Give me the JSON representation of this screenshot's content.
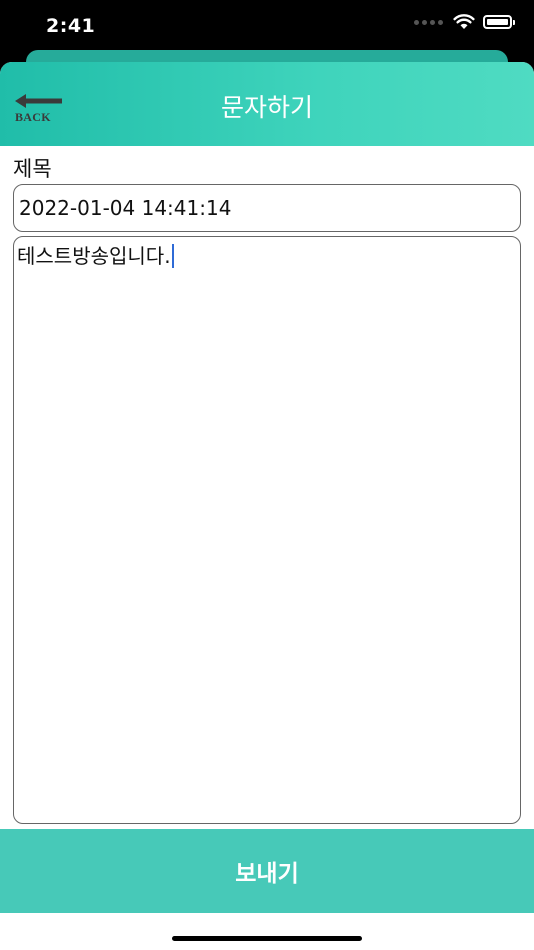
{
  "status": {
    "time": "2:41"
  },
  "nav": {
    "title": "문자하기",
    "back_label": "BACK"
  },
  "form": {
    "subject_label": "제목",
    "subject_value": "2022-01-04 14:41:14",
    "message_value": "테스트방송입니다."
  },
  "actions": {
    "send_label": "보내기"
  },
  "colors": {
    "header_start": "#20bda9",
    "header_end": "#4fdbc2",
    "send_button": "#47c9b8"
  }
}
